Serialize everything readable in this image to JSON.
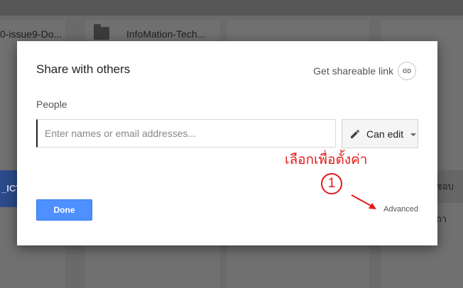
{
  "background": {
    "file_left": "0-issue9-Do...",
    "file_right": "InfoMation-Tech...",
    "left_strip_text": "_ICT",
    "right_strip_text": "ชอบถา"
  },
  "dialog": {
    "title": "Share with others",
    "share_link_label": "Get shareable link",
    "people_label": "People",
    "names_placeholder": "Enter names or email addresses...",
    "names_value": "",
    "permission_label": "Can edit",
    "done_label": "Done",
    "advanced_label": "Advanced"
  },
  "annotation": {
    "text": "เลือกเพื่อตั้งค่า",
    "step_number": "1",
    "color": "#e11c1c"
  },
  "colors": {
    "done_button": "#4d90fe",
    "overlay": "#666666"
  },
  "icons": {
    "share_link": "link-icon",
    "permission": "pencil-icon",
    "folder": "folder-icon"
  }
}
